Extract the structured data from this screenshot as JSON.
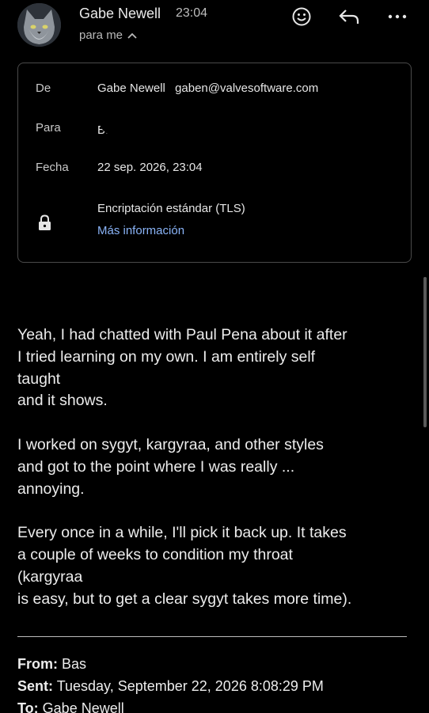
{
  "header": {
    "sender_name": "Gabe Newell",
    "time": "23:04",
    "to_line": "para me",
    "icons": {
      "emoji": "emoji-icon",
      "reply": "reply-icon",
      "more": "more-icon"
    }
  },
  "details": {
    "from_label": "De",
    "from_name": "Gabe Newell",
    "from_email": "gaben@valvesoftware.com",
    "to_label": "Para",
    "to_value": "Ba",
    "date_label": "Fecha",
    "date_value": "22 sep. 2026, 23:04",
    "encryption": "Encriptación estándar (TLS)",
    "more_info": "Más información"
  },
  "body": {
    "paragraphs": [
      [
        "Yeah, I had chatted with Paul Pena about it after",
        "I tried learning on my own.  I am entirely self",
        "taught",
        "and it shows."
      ],
      [
        "I worked on sygyt, kargyraa, and other styles",
        "and got to the point where I was really ...",
        "annoying."
      ],
      [
        "Every once in a while, I'll pick it back up.  It takes",
        "a couple of weeks to condition my throat",
        "(kargyraa",
        "is easy, but to get a clear sygyt takes more time)."
      ]
    ]
  },
  "forwarded": {
    "from_label": "From:",
    "from_value": "Bas",
    "sent_label": "Sent:",
    "sent_value": "Tuesday, September 22, 2026 8:08:29 PM",
    "to_label": "To:",
    "to_value": "Gabe Newell"
  },
  "colors": {
    "background": "#000000",
    "link": "#8ab4f8",
    "border": "#4a4a4a"
  }
}
